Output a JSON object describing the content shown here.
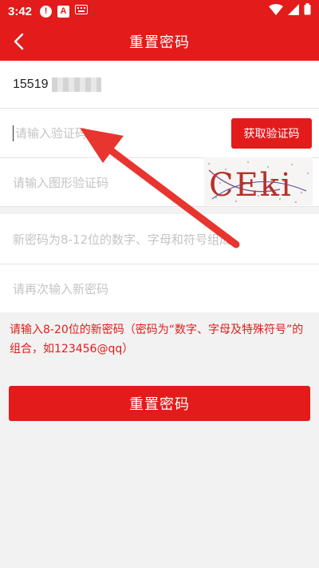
{
  "status_bar": {
    "time": "3:42",
    "icons": [
      "alert-icon",
      "a-icon",
      "keyboard-icon",
      "wifi-icon",
      "signal-icon",
      "battery-icon"
    ]
  },
  "header": {
    "title": "重置密码",
    "back_icon": "back-arrow-icon"
  },
  "form": {
    "phone_value": "15519",
    "verify_code_placeholder": "请输入验证码",
    "get_code_label": "获取验证码",
    "image_code_placeholder": "请输入图形验证码",
    "captcha_text": "CEki",
    "new_password_placeholder": "新密码为8-12位的数字、字母和符号组成",
    "confirm_password_placeholder": "请再次输入新密码"
  },
  "hint": "请输入8-20位的新密码（密码为“数字、字母及特殊符号”的组合，如123456@qq）",
  "reset_button_label": "重置密码",
  "colors": {
    "brand_red": "#e31b1b",
    "background": "#f2f2f2",
    "placeholder": "#c4c4c4"
  }
}
